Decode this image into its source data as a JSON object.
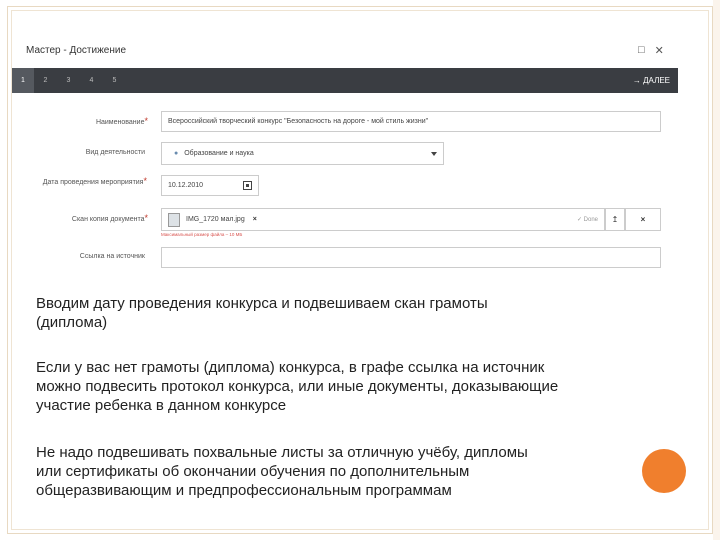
{
  "window": {
    "title": "Мастер - Достижение",
    "maximize_icon": "maximize-icon",
    "close_icon": "close-icon"
  },
  "wizard": {
    "steps": [
      "1",
      "2",
      "3",
      "4",
      "5"
    ],
    "next_label": "ДАЛЕЕ"
  },
  "form": {
    "name_label": "Наименование",
    "name_value": "Всероссийский творческий конкурс \"Безопасность на дороге - мой стиль жизни\"",
    "activity_label": "Вид деятельности",
    "activity_value": "Образование и наука",
    "date_label": "Дата проведения мероприятия",
    "date_value": "10.12.2010",
    "doc_label": "Скан копия документа",
    "doc_file": "IMG_1720 мал.jpg",
    "doc_status": "Done",
    "doc_hint": "Максимальный размер файла – 10 МБ",
    "link_label": "Ссылка на источник",
    "link_value": ""
  },
  "text": {
    "p1_line1": "Вводим дату проведения конкурса и подвешиваем скан грамоты",
    "p1_line2": "(диплома)",
    "p2_line1": "Если у вас нет грамоты (диплома) конкурса, в графе ссылка на источник",
    "p2_line2": "можно подвесить протокол конкурса, или иные документы, доказывающие",
    "p2_line3": "участие ребенка в данном конкурсе",
    "p3_line1": "Не надо подвешивать похвальные листы за отличную учёбу, дипломы",
    "p3_line2": "или сертификаты об окончании обучения по дополнительным",
    "p3_line3": "общеразвивающим и предпрофессиональным программам"
  },
  "colors": {
    "accent": "#f07f2d",
    "wizard_bar": "#3a3d42",
    "required": "#c0392b"
  }
}
